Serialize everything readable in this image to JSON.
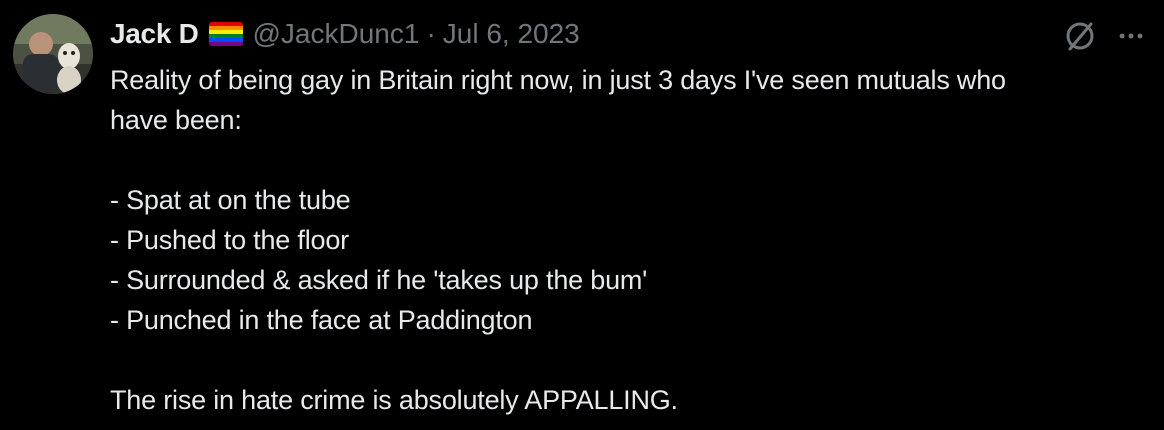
{
  "tweet": {
    "author": {
      "display_name": "Jack D",
      "flag_icon": "rainbow-flag-icon",
      "handle": "@JackDunc1",
      "separator": "·",
      "date": "Jul 6, 2023"
    },
    "actions": {
      "grok_icon": "slashed-circle-icon",
      "more_icon": "more-dots-icon"
    },
    "body": {
      "line1": "Reality of being gay in Britain right now, in just 3 days I've seen mutuals who",
      "line2": "have been:",
      "items": [
        "- Spat at on the tube",
        "- Pushed to the floor",
        "- Surrounded & asked if he 'takes up the bum'",
        "- Punched in the face at Paddington"
      ],
      "closing": "The rise in hate crime is absolutely APPALLING."
    }
  },
  "colors": {
    "background": "#000000",
    "primary_text": "#e7e9ea",
    "secondary_text": "#71767b"
  }
}
